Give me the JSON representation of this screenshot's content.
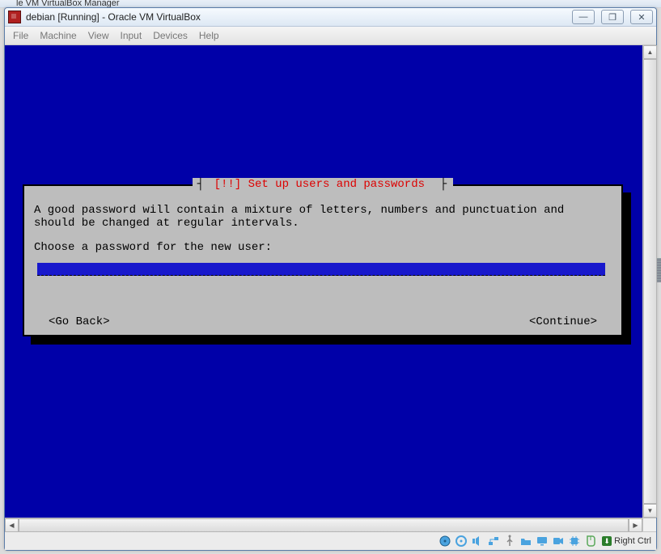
{
  "host_window": {
    "title_fragment": "le VM VirtualBox Manager"
  },
  "vm_window": {
    "title": "debian [Running] - Oracle VM VirtualBox",
    "menu": {
      "file": "File",
      "machine": "Machine",
      "view": "View",
      "input": "Input",
      "devices": "Devices",
      "help": "Help"
    },
    "win_buttons": {
      "min": "—",
      "max": "❐",
      "close": "✕"
    }
  },
  "installer": {
    "title_marker": "[!!]",
    "title_text": " Set up users and passwords ",
    "description": "A good password will contain a mixture of letters, numbers and punctuation and should be changed at regular intervals.",
    "prompt": "Choose a password for the new user:",
    "password_value": "",
    "go_back": "<Go Back>",
    "continue": "<Continue>"
  },
  "statusbar": {
    "host_key_label": "Right Ctrl"
  }
}
